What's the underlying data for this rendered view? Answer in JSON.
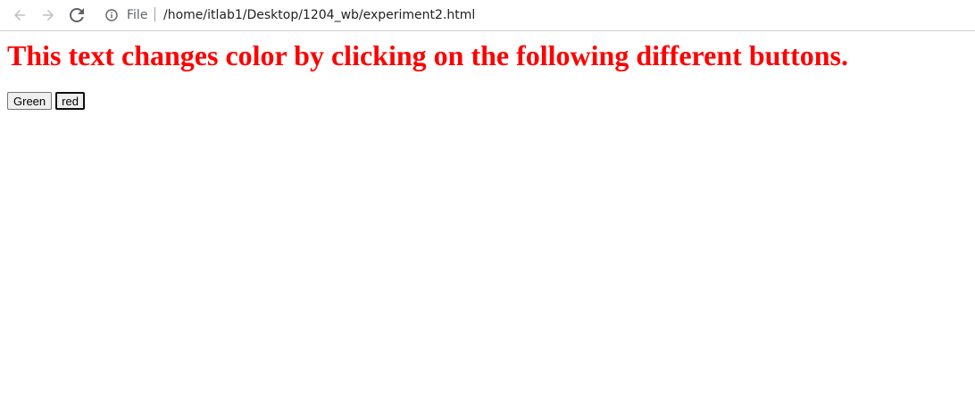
{
  "browser": {
    "scheme_label": "File",
    "url": "/home/itlab1/Desktop/1204_wb/experiment2.html",
    "icons": {
      "back": "back-arrow-icon",
      "forward": "forward-arrow-icon",
      "reload": "reload-icon",
      "info": "info-icon"
    }
  },
  "page": {
    "heading": "This text changes color by clicking on the following different buttons.",
    "heading_color": "#ff0000",
    "buttons": [
      {
        "label": "Green"
      },
      {
        "label": "red"
      }
    ]
  }
}
